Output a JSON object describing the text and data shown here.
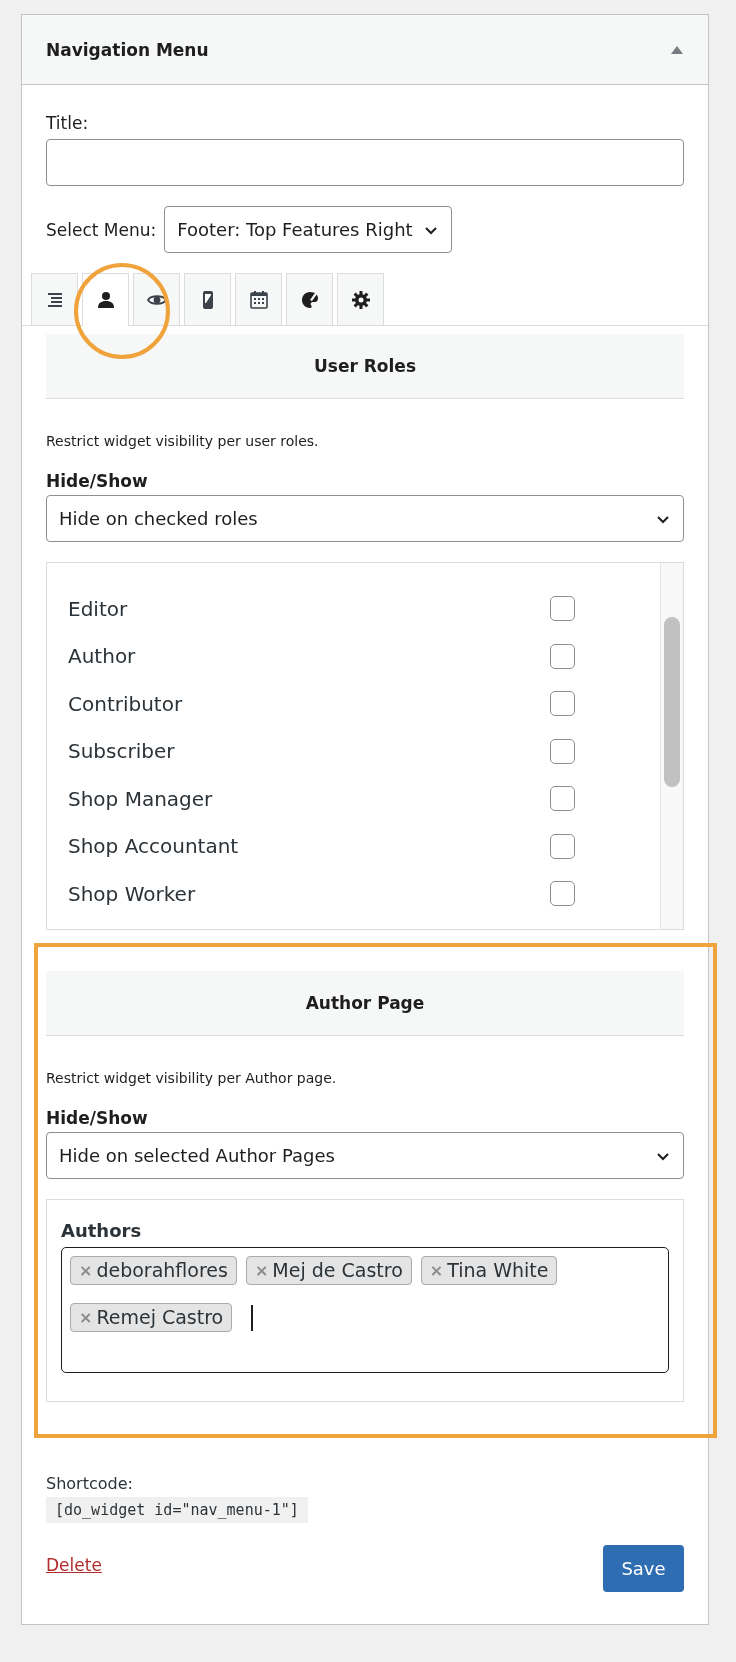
{
  "widget": {
    "title": "Navigation Menu",
    "expanded": true
  },
  "title_field": {
    "label": "Title:"
  },
  "select_menu": {
    "label": "Select Menu:",
    "value": "Footer: Top Features Right"
  },
  "tabs": [
    {
      "kind": "list",
      "selected": false
    },
    {
      "kind": "user",
      "selected": true
    },
    {
      "kind": "eye",
      "selected": false
    },
    {
      "kind": "phone",
      "selected": false
    },
    {
      "kind": "calendar",
      "selected": false
    },
    {
      "kind": "palette",
      "selected": false
    },
    {
      "kind": "gear",
      "selected": false
    }
  ],
  "user_roles": {
    "heading": "User Roles",
    "description": "Restrict widget visibility per user roles.",
    "hide_show_label": "Hide/Show",
    "hide_show_value": "Hide on checked roles",
    "roles": [
      {
        "name": "Editor",
        "checked": false
      },
      {
        "name": "Author",
        "checked": false
      },
      {
        "name": "Contributor",
        "checked": false
      },
      {
        "name": "Subscriber",
        "checked": false
      },
      {
        "name": "Shop Manager",
        "checked": false
      },
      {
        "name": "Shop Accountant",
        "checked": false
      },
      {
        "name": "Shop Worker",
        "checked": false
      }
    ]
  },
  "author_page": {
    "heading": "Author Page",
    "description": "Restrict widget visibility per Author page.",
    "hide_show_label": "Hide/Show",
    "hide_show_value": "Hide on selected Author Pages",
    "authors_label": "Authors",
    "authors": [
      {
        "name": "deborahflores",
        "remove": "×"
      },
      {
        "name": "Mej de Castro",
        "remove": "×"
      },
      {
        "name": "Tina White",
        "remove": "×"
      },
      {
        "name": "Remej Castro",
        "remove": "×"
      }
    ]
  },
  "shortcode": {
    "label": "Shortcode:",
    "code": "[do_widget id=\"nav_menu-1\"]"
  },
  "delete_link": "Delete",
  "save_button": "Save"
}
